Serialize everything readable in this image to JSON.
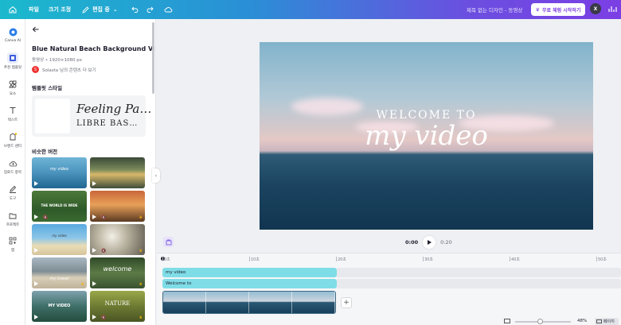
{
  "topbar": {
    "file": "파일",
    "resize": "크기 조정",
    "edit_mode": "편집 중",
    "doc_title": "제목 없는 디자인 - 동영상",
    "trial_button": "무료 체험 시작하기",
    "avatar_initial": "X"
  },
  "rail": {
    "items": [
      {
        "label": "Canva AI",
        "icon": "canva-ai-icon"
      },
      {
        "label": "추천 템플릿",
        "icon": "template-icon"
      },
      {
        "label": "요소",
        "icon": "elements-icon"
      },
      {
        "label": "텍스트",
        "icon": "text-icon"
      },
      {
        "label": "브랜드 센터",
        "icon": "brand-icon"
      },
      {
        "label": "업로드 항목",
        "icon": "upload-icon"
      },
      {
        "label": "도구",
        "icon": "draw-icon"
      },
      {
        "label": "프로젝트",
        "icon": "folder-icon"
      },
      {
        "label": "앱",
        "icon": "apps-icon"
      }
    ]
  },
  "panel": {
    "title": "Blue Natural Beach Background Video",
    "meta": "동영상 • 1920×1080 px",
    "author_initial": "S",
    "author": "Solasta 님의 콘텐츠 더 보기",
    "style_heading": "템플릿 스타일",
    "style_font1": "Feeling Pa…",
    "style_font2": "LIBRE BAS…",
    "similar_heading": "비슷한 버전",
    "thumbs": [
      {
        "text": "my video"
      },
      {
        "text": ""
      },
      {
        "text": "THE WORLD IS WIDE"
      },
      {
        "text": ""
      },
      {
        "text": "my video"
      },
      {
        "text": ""
      },
      {
        "text": "my travel"
      },
      {
        "text": "welcome"
      },
      {
        "text": "MY VIDEO"
      },
      {
        "text": "NATURE"
      }
    ]
  },
  "canvas": {
    "line1": "WELCOME TO",
    "line2": "my video"
  },
  "playback": {
    "current": "0:00",
    "duration": "0:20"
  },
  "timeline": {
    "ticks": [
      "0초",
      "10초",
      "20초",
      "30초",
      "40초",
      "50초"
    ],
    "tracks": [
      {
        "label": "my video"
      },
      {
        "label": "Welcome to"
      }
    ]
  },
  "footer": {
    "zoom": "48%",
    "pages": "페이지"
  }
}
